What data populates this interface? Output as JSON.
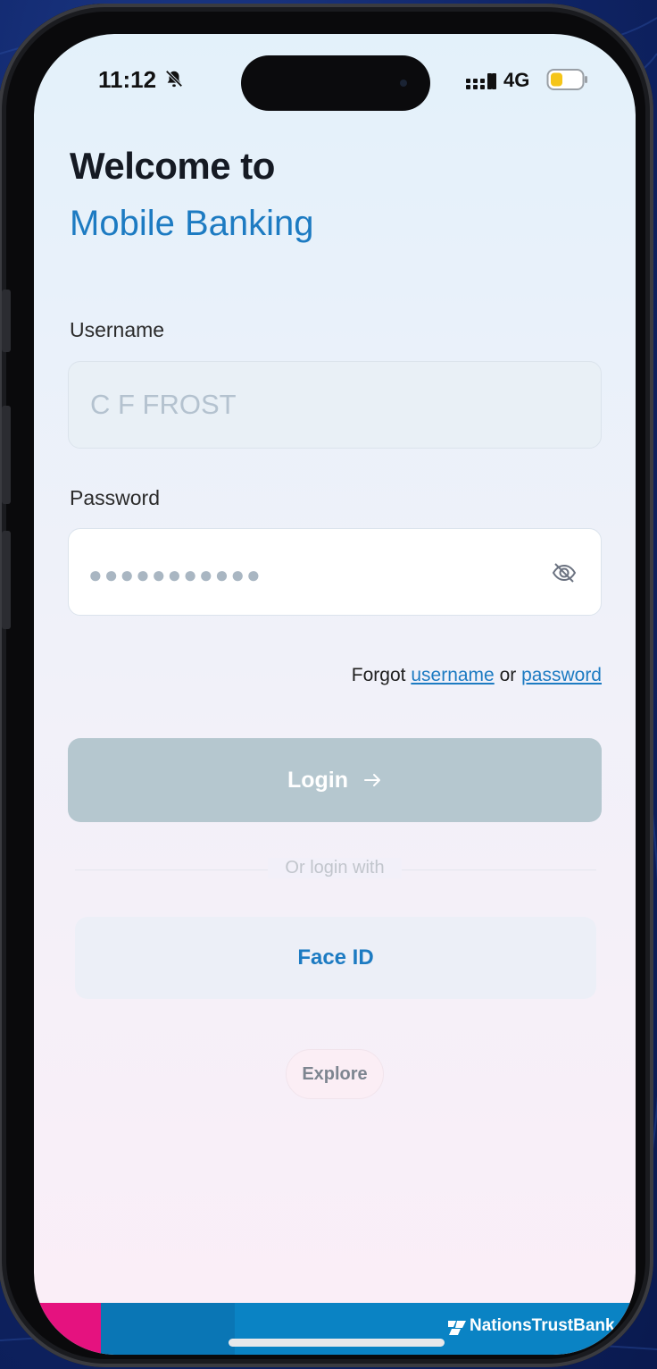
{
  "status_bar": {
    "time": "11:12",
    "network": "4G",
    "bell_icon": "bell-slash-icon",
    "signal_icon": "signal-bars-icon",
    "battery_icon": "battery-low-icon",
    "battery_color": "#f5c518"
  },
  "header": {
    "welcome": "Welcome to",
    "app_name": "Mobile Banking"
  },
  "form": {
    "username_label": "Username",
    "username_value": "C F FROST",
    "password_label": "Password",
    "password_value": "●●●●●●●●●●●",
    "password_toggle_icon": "eye-slash-icon"
  },
  "forgot": {
    "prefix": "Forgot",
    "username_link": "username",
    "or": "or",
    "password_link": "password"
  },
  "actions": {
    "login_label": "Login",
    "login_icon": "arrow-right-icon",
    "divider_text": "Or login with",
    "face_id_label": "Face ID",
    "explore_label": "Explore"
  },
  "footer": {
    "brand": "NationsTrustBank",
    "brand_colors": [
      "#e5127f",
      "#0a76b5",
      "#0a83c4"
    ]
  },
  "colors": {
    "accent": "#1d7bc2",
    "login_disabled": "#b5c7cf"
  }
}
